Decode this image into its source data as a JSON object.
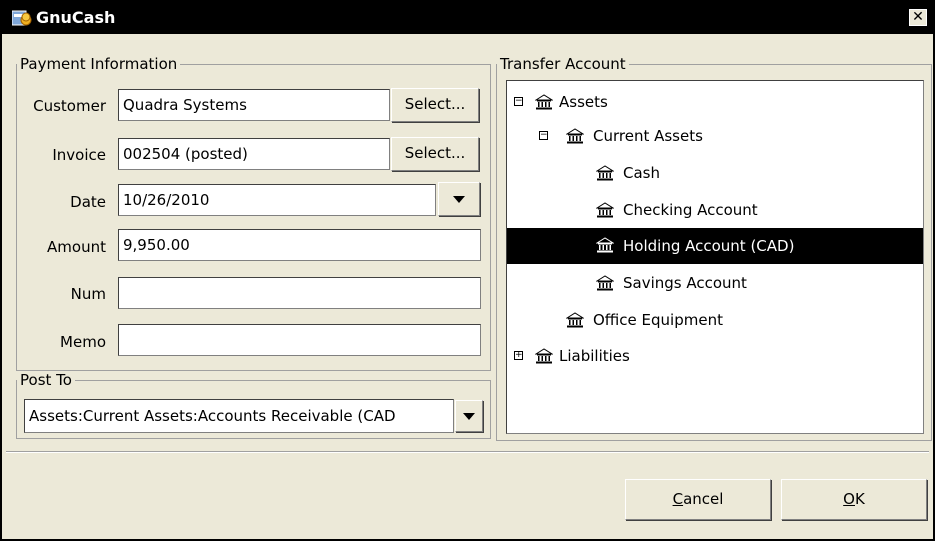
{
  "window": {
    "title": "GnuCash"
  },
  "payment_info": {
    "legend": "Payment Information",
    "customer": {
      "label": "Customer",
      "value": "Quadra Systems",
      "select_label": "Select..."
    },
    "invoice": {
      "label": "Invoice",
      "value": "002504 (posted)",
      "select_label": "Select..."
    },
    "date": {
      "label": "Date",
      "value": "10/26/2010"
    },
    "amount": {
      "label": "Amount",
      "value": "9,950.00"
    },
    "num": {
      "label": "Num",
      "value": ""
    },
    "memo": {
      "label": "Memo",
      "value": ""
    }
  },
  "post_to": {
    "legend": "Post To",
    "value": "Assets:Current Assets:Accounts Receivable (CAD"
  },
  "transfer": {
    "legend": "Transfer Account",
    "tree": [
      {
        "label": "Assets",
        "expander": "minus",
        "selected": false
      },
      {
        "label": "Current Assets",
        "expander": "minus",
        "selected": false
      },
      {
        "label": "Cash",
        "expander": "",
        "selected": false
      },
      {
        "label": "Checking Account",
        "expander": "",
        "selected": false
      },
      {
        "label": "Holding Account (CAD)",
        "expander": "",
        "selected": true
      },
      {
        "label": "Savings Account",
        "expander": "",
        "selected": false
      },
      {
        "label": "Office Equipment",
        "expander": "",
        "selected": false
      },
      {
        "label": "Liabilities",
        "expander": "plus",
        "selected": false
      }
    ]
  },
  "buttons": {
    "cancel_mnemonic": "C",
    "cancel_rest": "ancel",
    "ok_mnemonic": "O",
    "ok_rest": "K"
  },
  "icons": {
    "window": "gnucash-app-icon",
    "account": "bank-building-icon"
  },
  "colors": {
    "selection": "#000000",
    "dialog_bg": "#ece9d8"
  }
}
